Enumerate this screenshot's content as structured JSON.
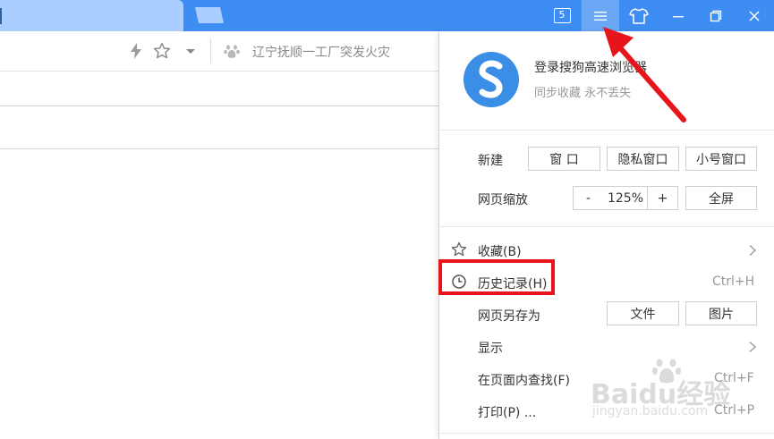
{
  "titlebar": {
    "tab_count": "5",
    "icons": [
      "new-tab-icon",
      "tab-count-icon",
      "menu-icon",
      "skin-icon",
      "minimize-icon",
      "restore-icon",
      "close-icon"
    ]
  },
  "toolbar": {
    "icons": [
      "lightning-icon",
      "star-icon",
      "dropdown-icon",
      "paw-icon"
    ],
    "search_hint": "辽宁抚顺一工厂突发火灾"
  },
  "menu": {
    "login_title": "登录搜狗高速浏览器",
    "login_subtitle": "同步收藏 永不丢失",
    "new_label": "新建",
    "new_window": "窗 口",
    "private_window": "隐私窗口",
    "small_window": "小号窗口",
    "zoom_label": "网页缩放",
    "zoom_minus": "-",
    "zoom_value": "125%",
    "zoom_plus": "+",
    "fullscreen": "全屏",
    "favorites": "收藏(B)",
    "history": "历史记录(H)",
    "history_shortcut": "Ctrl+H",
    "save_as": "网页另存为",
    "save_file": "文件",
    "save_image": "图片",
    "display": "显示",
    "find": "在页面内查找(F)",
    "find_shortcut": "Ctrl+F",
    "print": "打印(P) ...",
    "print_shortcut": "Ctrl+P"
  },
  "watermark": {
    "brand": "Baidu经验",
    "url": "jingyan.baidu.com"
  },
  "colors": {
    "titlebar": "#3d8df2",
    "active_tab": "#a9ceff",
    "highlight_button": "#6aa7f5",
    "annotation_red": "#e8141b",
    "logo_blue": "#3a8ee6"
  }
}
